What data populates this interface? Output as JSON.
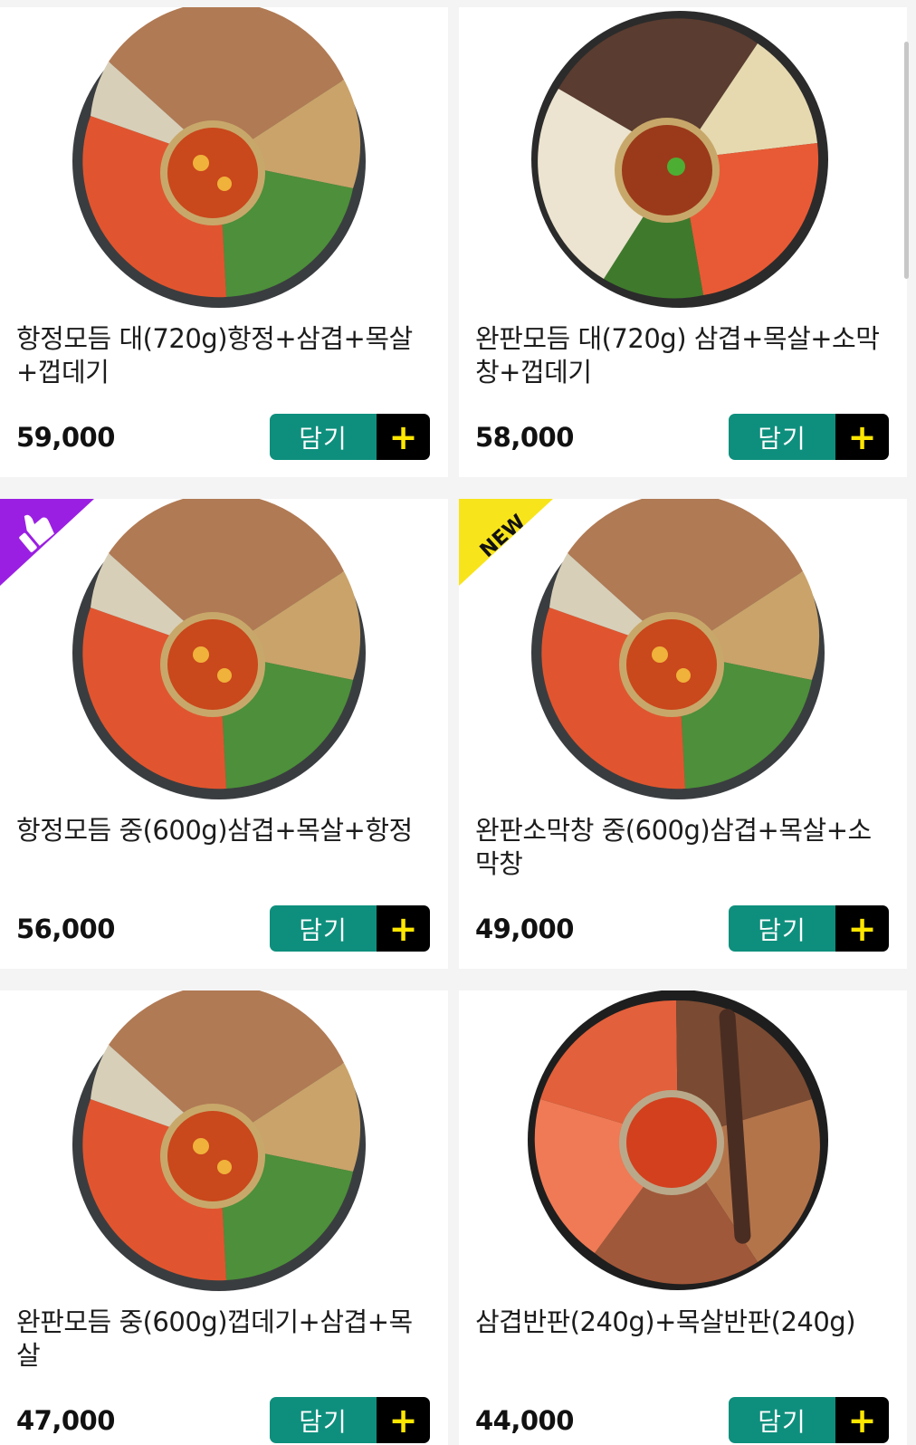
{
  "cart_label": "담기",
  "plus_symbol": "+",
  "colors": {
    "cart_green": "#0e8f7d",
    "cart_black": "#000000",
    "plus_yellow": "#ffe600",
    "badge_purple": "#9b1fe3",
    "badge_yellow": "#f8e41a"
  },
  "products": [
    {
      "name": "항정모듬 대(720g)항정+삼겹+목살+껍데기",
      "price": "59,000",
      "image": "mixed-grill-stone-plate",
      "badge": ""
    },
    {
      "name": "완판모듬 대(720g) 삼겹+목살+소막창+껍데기",
      "price": "58,000",
      "image": "dark-grill-stone-plate",
      "badge": ""
    },
    {
      "name": "항정모듬 중(600g)삼겹+목살+항정",
      "price": "56,000",
      "image": "mixed-grill-stone-plate",
      "badge": "thumbs-up-icon"
    },
    {
      "name": "완판소막창 중(600g)삼겹+목살+소막창",
      "price": "49,000",
      "image": "mixed-grill-stone-plate",
      "badge": "NEW"
    },
    {
      "name": "완판모듬 중(600g)껍데기+삼겹+목살",
      "price": "47,000",
      "image": "mixed-grill-stone-plate",
      "badge": ""
    },
    {
      "name": "삼겹반판(240g)+목살반판(240g)",
      "price": "44,000",
      "image": "kimchi-pork-stone-plate",
      "badge": ""
    }
  ]
}
